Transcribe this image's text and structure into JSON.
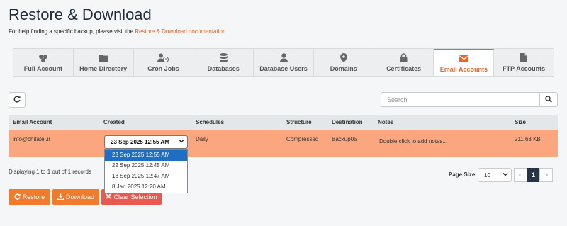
{
  "header": {
    "title": "Restore & Download",
    "help_prefix": "For help finding a specific backup, please visit the ",
    "help_link": "Restore & Download documentation",
    "help_suffix": "."
  },
  "tabs": [
    {
      "label": "Full Account",
      "icon": "full-account-icon"
    },
    {
      "label": "Home Directory",
      "icon": "folder-icon"
    },
    {
      "label": "Cron Jobs",
      "icon": "user-clock-icon"
    },
    {
      "label": "Databases",
      "icon": "database-icon"
    },
    {
      "label": "Database Users",
      "icon": "user-icon"
    },
    {
      "label": "Domains",
      "icon": "map-pin-icon"
    },
    {
      "label": "Certificates",
      "icon": "lock-icon"
    },
    {
      "label": "Email Accounts",
      "icon": "envelope-icon",
      "active": true
    },
    {
      "label": "FTP Accounts",
      "icon": "file-icon"
    }
  ],
  "search": {
    "placeholder": "Search"
  },
  "table": {
    "columns": [
      "Email Account",
      "Created",
      "Schedules",
      "Structure",
      "Destination",
      "Notes",
      "Size"
    ],
    "rows": [
      {
        "email": "info@chitatel.ir",
        "created": "23 Sep 2025 12:55 AM",
        "schedule": "Daily",
        "structure": "Compressed",
        "destination": "Backup05",
        "notes": "Double click to add notes...",
        "size": "211.63 KB"
      }
    ]
  },
  "created_dropdown": {
    "options": [
      "23 Sep 2025 12:55 AM",
      "22 Sep 2025 12:45 AM",
      "18 Sep 2025 12:47 AM",
      "8 Jan 2025 12:20 AM"
    ],
    "selected_index": 0
  },
  "footer": {
    "displaying": "Displaying 1 to 1 out of 1 records",
    "page_size_label": "Page Size",
    "page_size": "10",
    "prev": "<",
    "page": "1",
    "next": ">"
  },
  "actions": {
    "restore": "Restore",
    "download": "Download",
    "clear": "Clear Selection"
  },
  "colors": {
    "accent": "#e8652c",
    "selected_row": "#fba67f",
    "button_orange": "#f07b2b",
    "button_red": "#e85a4f"
  }
}
